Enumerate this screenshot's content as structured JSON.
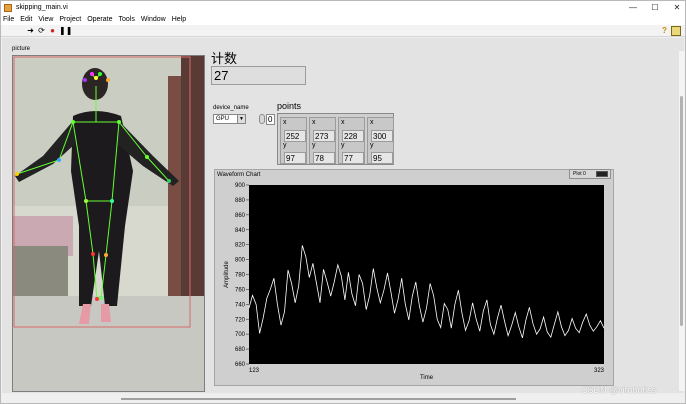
{
  "window": {
    "title": "skipping_main.vi",
    "controls": [
      "—",
      "☐",
      "✕"
    ]
  },
  "menu": [
    "File",
    "Edit",
    "View",
    "Project",
    "Operate",
    "Tools",
    "Window",
    "Help"
  ],
  "toolbar": {
    "icons": [
      "run-arrow-icon",
      "run-continuously-icon",
      "abort-icon",
      "pause-icon"
    ],
    "help": "?"
  },
  "picture": {
    "label": "picture"
  },
  "count": {
    "label": "计数",
    "value": "27"
  },
  "device": {
    "label": "device_name",
    "value": "GPU"
  },
  "points": {
    "label": "points",
    "index": "0",
    "items": [
      {
        "x_label": "x",
        "x": "252",
        "y_label": "y",
        "y": "97"
      },
      {
        "x_label": "x",
        "x": "273",
        "y_label": "y",
        "y": "78"
      },
      {
        "x_label": "x",
        "x": "228",
        "y_label": "y",
        "y": "77"
      },
      {
        "x_label": "x",
        "x": "300",
        "y_label": "y",
        "y": "95"
      }
    ]
  },
  "waveform": {
    "title": "Waveform Chart",
    "legend": "Plot 0",
    "xlabel": "Time",
    "ylabel": "Amplitude"
  },
  "watermark": "CSDN @virobotics",
  "colors": {
    "plot_bg": "#000000",
    "trace": "#ffffff",
    "skeleton": "#66ff33",
    "pic_border": "#d66b6b"
  },
  "chart_data": {
    "type": "line",
    "title": "Waveform Chart",
    "xlabel": "Time",
    "ylabel": "Amplitude",
    "xlim": [
      123,
      323
    ],
    "ylim": [
      660,
      900
    ],
    "yticks": [
      660,
      680,
      700,
      720,
      740,
      760,
      780,
      800,
      820,
      840,
      860,
      880,
      900
    ],
    "xticks": [
      123,
      323
    ],
    "grid": false,
    "legend": "top-right",
    "series": [
      {
        "name": "Plot 0",
        "x": [
          123,
          125,
          127,
          129,
          131,
          133,
          135,
          137,
          139,
          141,
          143,
          145,
          147,
          149,
          151,
          153,
          155,
          157,
          159,
          161,
          163,
          165,
          167,
          169,
          171,
          173,
          175,
          177,
          179,
          181,
          183,
          185,
          187,
          189,
          191,
          193,
          195,
          197,
          199,
          201,
          203,
          205,
          207,
          209,
          211,
          213,
          215,
          217,
          219,
          221,
          223,
          225,
          227,
          229,
          231,
          233,
          235,
          237,
          239,
          241,
          243,
          245,
          247,
          249,
          251,
          253,
          255,
          257,
          259,
          261,
          263,
          265,
          267,
          269,
          271,
          273,
          275,
          277,
          279,
          281,
          283,
          285,
          287,
          289,
          291,
          293,
          295,
          297,
          299,
          301,
          303,
          305,
          307,
          309,
          311,
          313,
          315,
          317,
          319,
          321,
          323
        ],
        "values": [
          735,
          752,
          740,
          701,
          722,
          748,
          760,
          775,
          740,
          712,
          730,
          786,
          768,
          742,
          765,
          819,
          804,
          776,
          795,
          768,
          742,
          787,
          770,
          751,
          770,
          793,
          778,
          746,
          783,
          754,
          738,
          780,
          768,
          733,
          752,
          788,
          762,
          742,
          759,
          782,
          756,
          728,
          747,
          775,
          741,
          719,
          751,
          770,
          738,
          716,
          735,
          768,
          752,
          720,
          709,
          741,
          733,
          708,
          740,
          759,
          728,
          705,
          718,
          742,
          720,
          704,
          731,
          746,
          713,
          700,
          722,
          739,
          717,
          698,
          712,
          729,
          710,
          695,
          719,
          736,
          714,
          700,
          707,
          723,
          703,
          696,
          713,
          730,
          710,
          698,
          705,
          721,
          708,
          702,
          716,
          727,
          712,
          704,
          710,
          718,
          708
        ]
      }
    ]
  }
}
